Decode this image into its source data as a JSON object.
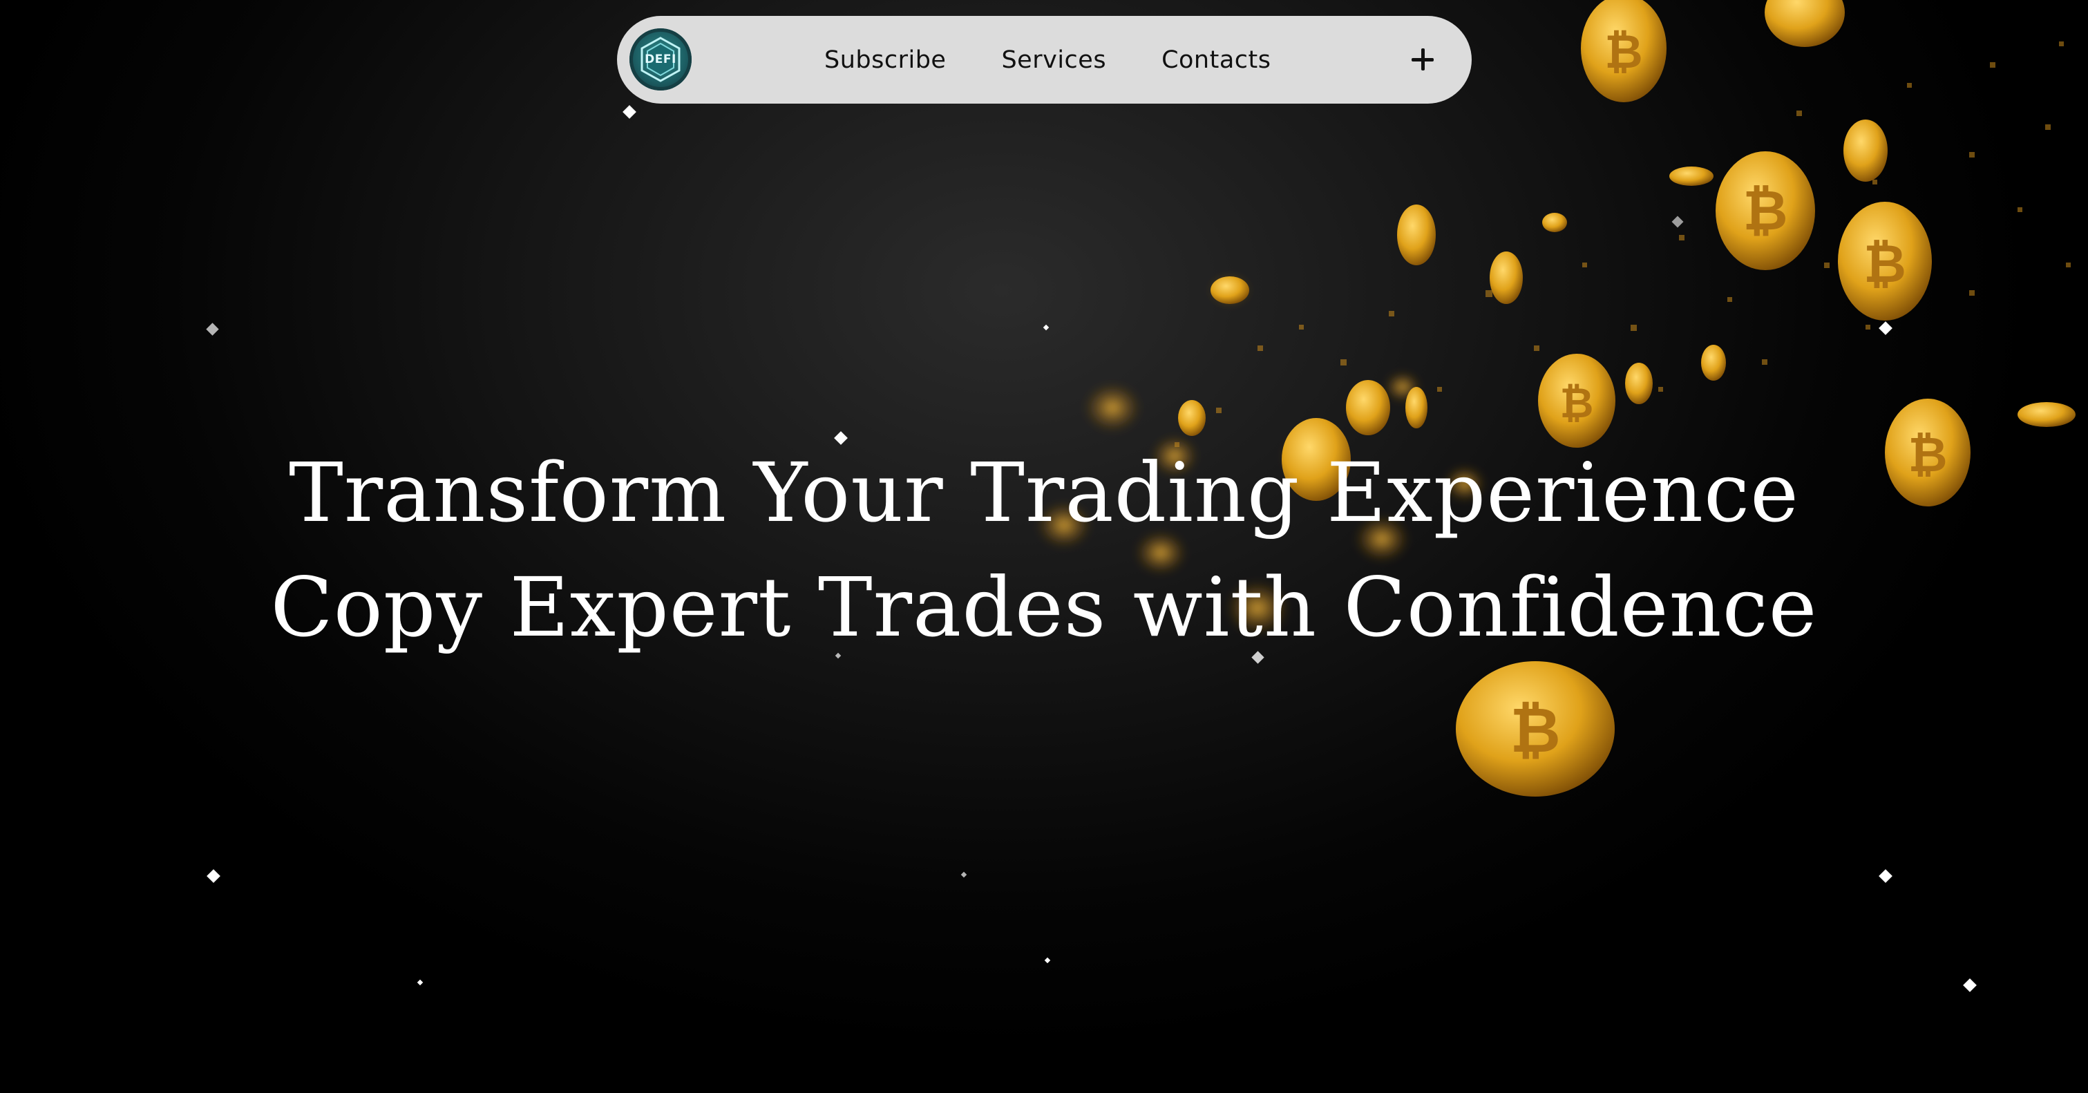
{
  "nav": {
    "logo_text": "DEFI",
    "links": [
      "Subscribe",
      "Services",
      "Contacts"
    ],
    "plus_icon": "plus-icon"
  },
  "hero": {
    "line1": "Transform Your Trading Experience",
    "line2": "Copy Expert Trades with Confidence"
  },
  "colors": {
    "background": "#000000",
    "nav_bg": "#dcdcdc",
    "coin_gold": "#e0a21a",
    "text": "#ffffff"
  }
}
